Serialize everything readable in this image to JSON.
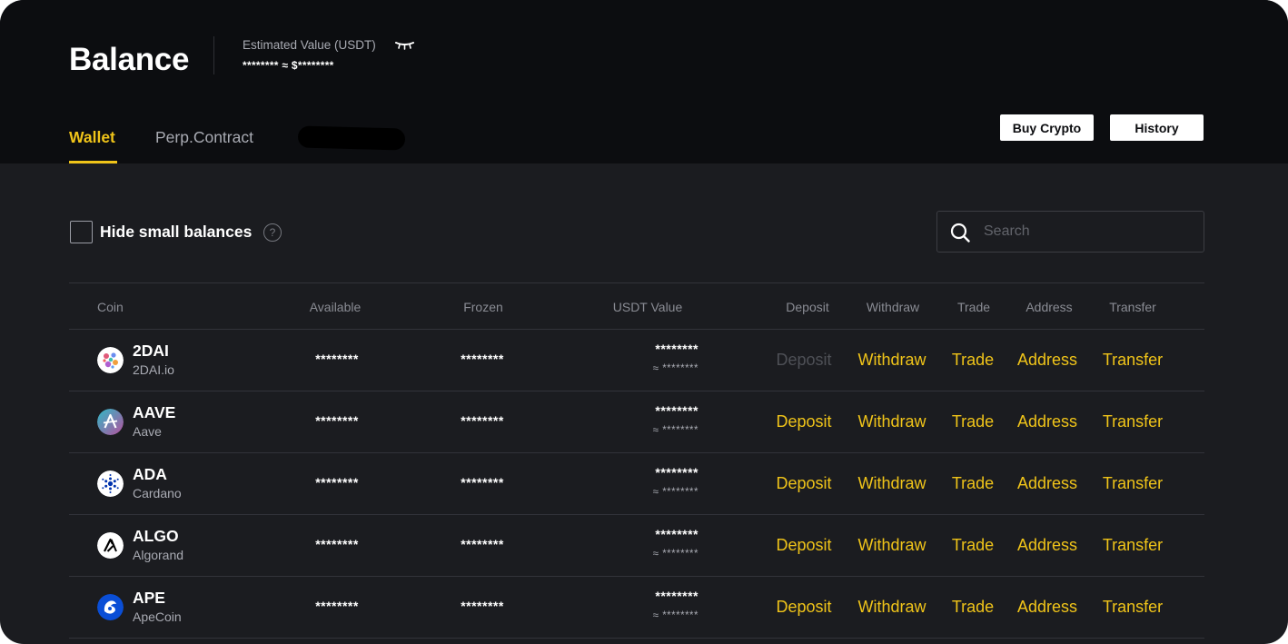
{
  "header": {
    "title": "Balance",
    "estimated_label": "Estimated Value (USDT)",
    "estimated_value": "******** ≈ $********",
    "tabs": [
      {
        "label": "Wallet",
        "active": true
      },
      {
        "label": "Perp.Contract",
        "active": false
      }
    ],
    "buy_crypto_label": "Buy Crypto",
    "history_label": "History"
  },
  "toolbar": {
    "hide_small_label": "Hide small balances",
    "hide_small_checked": false,
    "help_glyph": "?",
    "search_placeholder": "Search"
  },
  "table": {
    "columns": {
      "coin": "Coin",
      "available": "Available",
      "frozen": "Frozen",
      "usdt_value": "USDT Value",
      "deposit": "Deposit",
      "withdraw": "Withdraw",
      "trade": "Trade",
      "address": "Address",
      "transfer": "Transfer"
    },
    "rows": [
      {
        "symbol": "2DAI",
        "name": "2DAI.io",
        "available": "********",
        "frozen": "********",
        "usdt": "********",
        "usdt_approx": "≈ ********",
        "deposit": "Deposit",
        "deposit_enabled": false,
        "withdraw": "Withdraw",
        "trade": "Trade",
        "address": "Address",
        "transfer": "Transfer",
        "icon": "2dai-icon"
      },
      {
        "symbol": "AAVE",
        "name": "Aave",
        "available": "********",
        "frozen": "********",
        "usdt": "********",
        "usdt_approx": "≈ ********",
        "deposit": "Deposit",
        "deposit_enabled": true,
        "withdraw": "Withdraw",
        "trade": "Trade",
        "address": "Address",
        "transfer": "Transfer",
        "icon": "aave-icon"
      },
      {
        "symbol": "ADA",
        "name": "Cardano",
        "available": "********",
        "frozen": "********",
        "usdt": "********",
        "usdt_approx": "≈ ********",
        "deposit": "Deposit",
        "deposit_enabled": true,
        "withdraw": "Withdraw",
        "trade": "Trade",
        "address": "Address",
        "transfer": "Transfer",
        "icon": "cardano-icon"
      },
      {
        "symbol": "ALGO",
        "name": "Algorand",
        "available": "********",
        "frozen": "********",
        "usdt": "********",
        "usdt_approx": "≈ ********",
        "deposit": "Deposit",
        "deposit_enabled": true,
        "withdraw": "Withdraw",
        "trade": "Trade",
        "address": "Address",
        "transfer": "Transfer",
        "icon": "algorand-icon"
      },
      {
        "symbol": "APE",
        "name": "ApeCoin",
        "available": "********",
        "frozen": "********",
        "usdt": "********",
        "usdt_approx": "≈ ********",
        "deposit": "Deposit",
        "deposit_enabled": true,
        "withdraw": "Withdraw",
        "trade": "Trade",
        "address": "Address",
        "transfer": "Transfer",
        "icon": "apecoin-icon"
      }
    ]
  },
  "colors": {
    "accent": "#f0c419",
    "header_bg": "#0c0d10",
    "page_bg": "#1b1c20",
    "muted_text": "#a9abb3",
    "disabled_action": "#4e5056"
  }
}
